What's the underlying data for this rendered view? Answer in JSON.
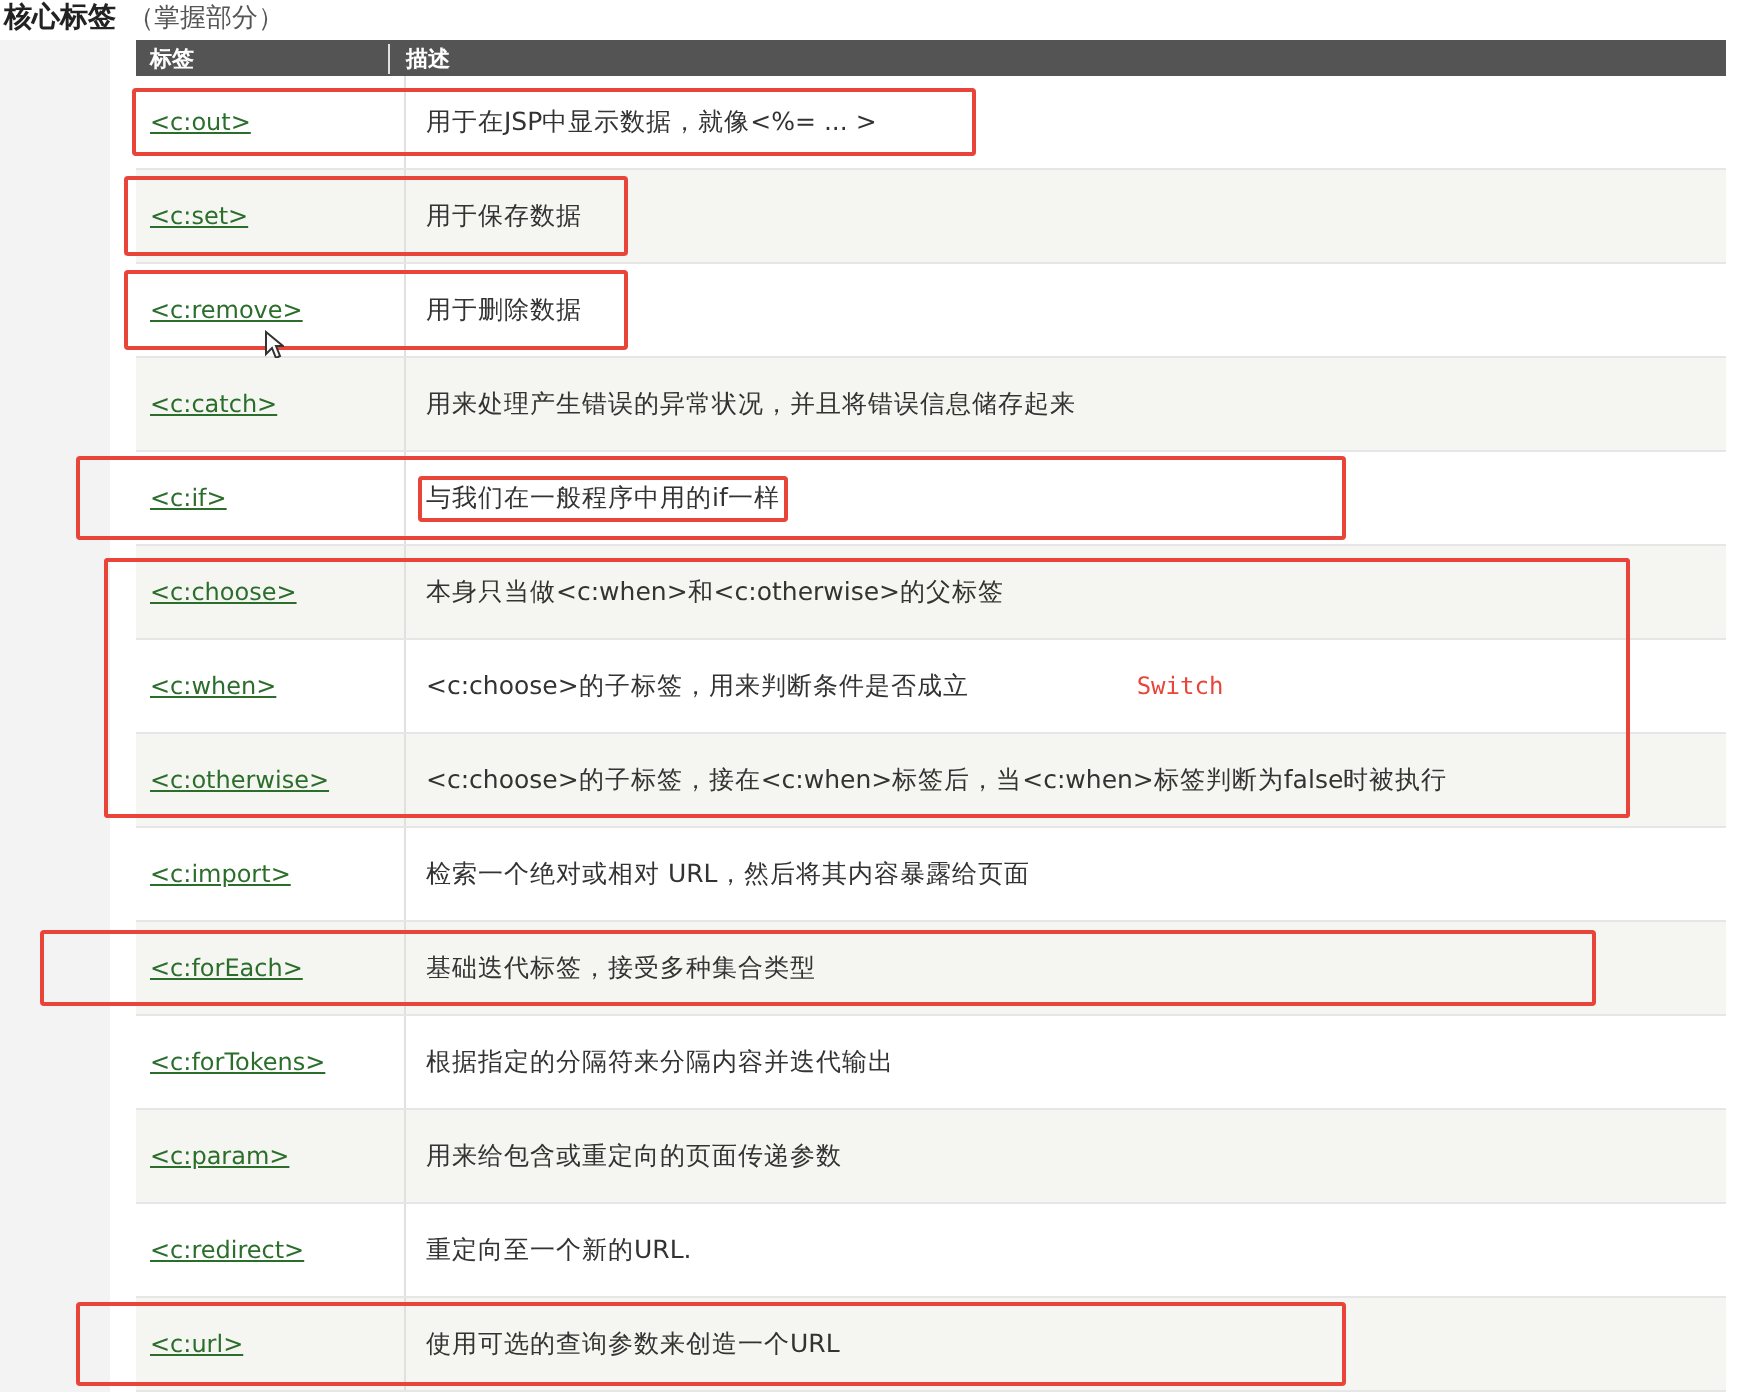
{
  "heading": {
    "title": "核心标签",
    "subtitle": "（掌握部分）"
  },
  "table": {
    "columns": [
      "标签",
      "描述"
    ],
    "rows": [
      {
        "tag": "<c:out>",
        "description": "用于在JSP中显示数据，就像<%= ... >",
        "annotation": {
          "kind": "medium"
        },
        "inner_box": false,
        "cursor": false
      },
      {
        "tag": "<c:set>",
        "description": "用于保存数据",
        "annotation": {
          "kind": "short"
        },
        "inner_box": false,
        "cursor": false
      },
      {
        "tag": "<c:remove>",
        "description": "用于删除数据",
        "annotation": {
          "kind": "short"
        },
        "inner_box": false,
        "cursor": true
      },
      {
        "tag": "<c:catch>",
        "description": "用来处理产生错误的异常状况，并且将错误信息储存起来",
        "inner_box": false,
        "cursor": false
      },
      {
        "tag": "<c:if>",
        "description": "与我们在一般程序中用的if一样",
        "annotation": {
          "kind": "long"
        },
        "inner_box": true,
        "cursor": false
      },
      {
        "tag": "<c:choose>",
        "description": "本身只当做<c:when>和<c:otherwise>的父标签",
        "annotation": {
          "kind": "groupstart"
        },
        "inner_box": false,
        "cursor": false
      },
      {
        "tag": "<c:when>",
        "description": "<c:choose>的子标签，用来判断条件是否成立",
        "annotation": {
          "kind": "groupmid"
        },
        "inner_box": false,
        "cursor": false,
        "note": "Switch"
      },
      {
        "tag": "<c:otherwise>",
        "description": "<c:choose>的子标签，接在<c:when>标签后，当<c:when>标签判断为false时被执行",
        "annotation": {
          "kind": "groupend"
        },
        "inner_box": false,
        "cursor": false
      },
      {
        "tag": "<c:import>",
        "description": "检索一个绝对或相对 URL，然后将其内容暴露给页面",
        "inner_box": false,
        "cursor": false
      },
      {
        "tag": "<c:forEach>",
        "description": "基础迭代标签，接受多种集合类型",
        "annotation": {
          "kind": "wide"
        },
        "inner_box": false,
        "cursor": false
      },
      {
        "tag": "<c:forTokens>",
        "description": "根据指定的分隔符来分隔内容并迭代输出",
        "inner_box": false,
        "cursor": false
      },
      {
        "tag": "<c:param>",
        "description": "用来给包含或重定向的页面传递参数",
        "inner_box": false,
        "cursor": false
      },
      {
        "tag": "<c:redirect>",
        "description": "重定向至一个新的URL.",
        "inner_box": false,
        "cursor": false
      },
      {
        "tag": "<c:url>",
        "description": "使用可选的查询参数来创造一个URL",
        "annotation": {
          "kind": "long"
        },
        "inner_box": false,
        "cursor": false
      }
    ]
  }
}
